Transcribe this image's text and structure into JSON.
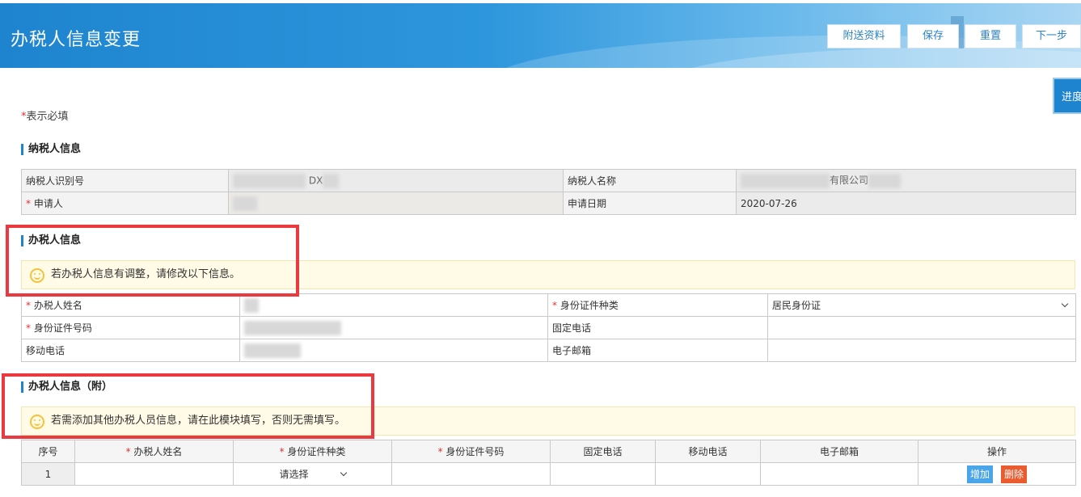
{
  "header": {
    "title": "办税人信息变更",
    "buttons": {
      "attach": "附送资料",
      "save": "保存",
      "reset": "重置",
      "next": "下一步"
    }
  },
  "progress_tab": "进度",
  "required_note": {
    "star": "*",
    "text": "表示必填"
  },
  "taxpayer_section": {
    "title": "纳税人信息",
    "id_label": "纳税人识别号",
    "id_value_partial": "DX",
    "name_label": "纳税人名称",
    "name_value_partial": "有限公司",
    "applicant_label": "申请人",
    "date_label": "申请日期",
    "date_value": "2020-07-26"
  },
  "agent_section": {
    "title": "办税人信息",
    "notice": "若办税人信息有调整，请修改以下信息。",
    "name_label": "办税人姓名",
    "id_type_label": "身份证件种类",
    "id_type_value": "居民身份证",
    "id_number_label": "身份证件号码",
    "phone_label": "固定电话",
    "mobile_label": "移动电话",
    "email_label": "电子邮箱"
  },
  "extra_section": {
    "title": "办税人信息（附）",
    "notice": "若需添加其他办税人员信息，请在此模块填写，否则无需填写。",
    "columns": [
      "序号",
      "办税人姓名",
      "身份证件种类",
      "身份证件号码",
      "固定电话",
      "移动电话",
      "电子邮箱",
      "操作"
    ],
    "rows": [
      {
        "index": "1",
        "id_type_placeholder": "请选择"
      }
    ],
    "add_label": "增加",
    "delete_label": "删除"
  }
}
